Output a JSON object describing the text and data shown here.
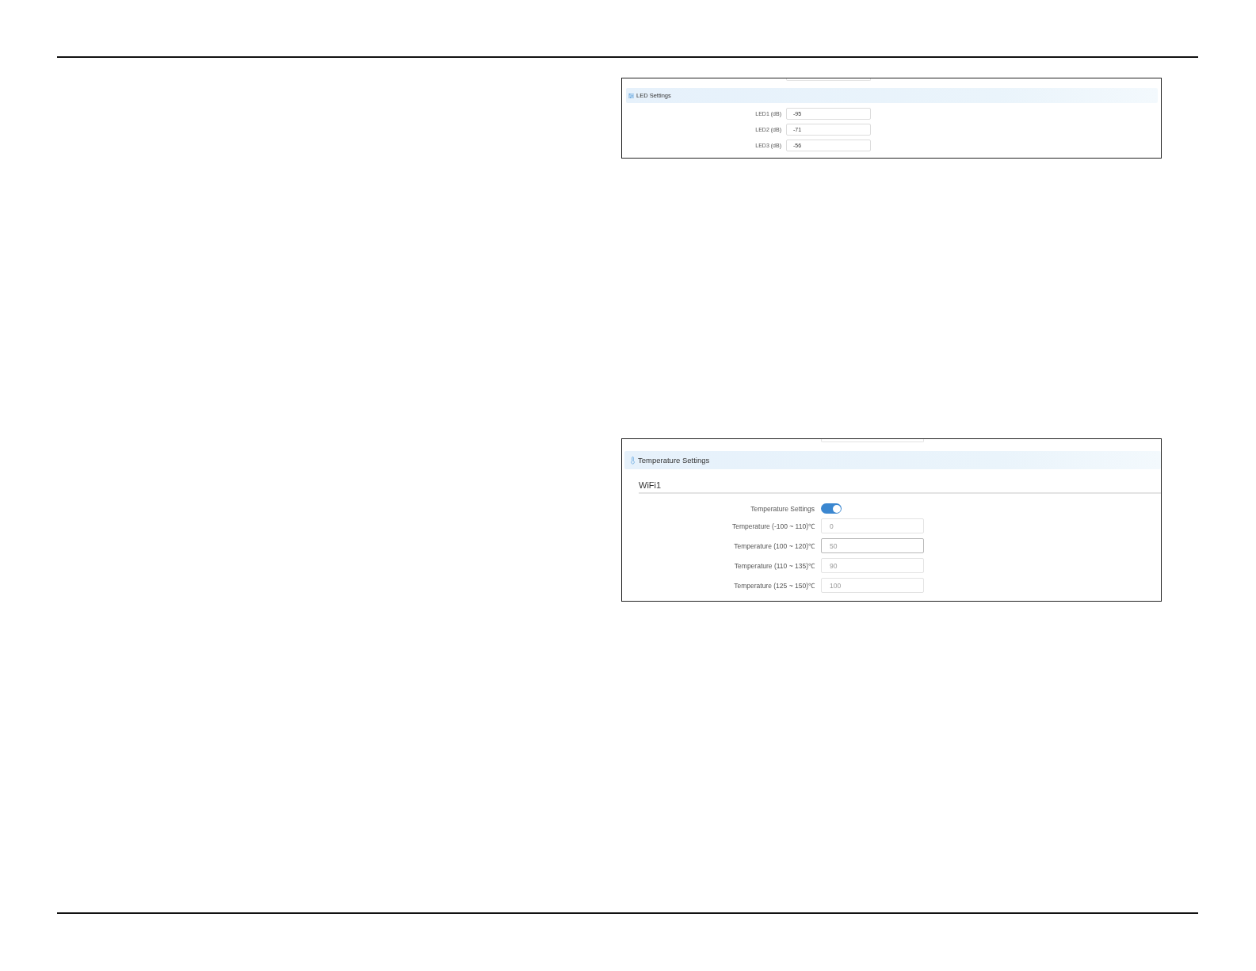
{
  "led_settings": {
    "title": "LED Settings",
    "fields": [
      {
        "label": "LED1 (dB)",
        "value": "-95"
      },
      {
        "label": "LED2 (dB)",
        "value": "-71"
      },
      {
        "label": "LED3 (dB)",
        "value": "-56"
      }
    ]
  },
  "temperature_settings": {
    "title": "Temperature Settings",
    "section": "WiFi1",
    "toggle": {
      "label": "Temperature Settings",
      "on": true
    },
    "fields": [
      {
        "label": "Temperature (-100 ~ 110)℃",
        "placeholder": "0",
        "focused": false
      },
      {
        "label": "Temperature (100 ~ 120)℃",
        "placeholder": "50",
        "focused": true
      },
      {
        "label": "Temperature (110 ~ 135)℃",
        "placeholder": "90",
        "focused": false
      },
      {
        "label": "Temperature (125 ~ 150)℃",
        "placeholder": "100",
        "focused": false
      }
    ]
  }
}
